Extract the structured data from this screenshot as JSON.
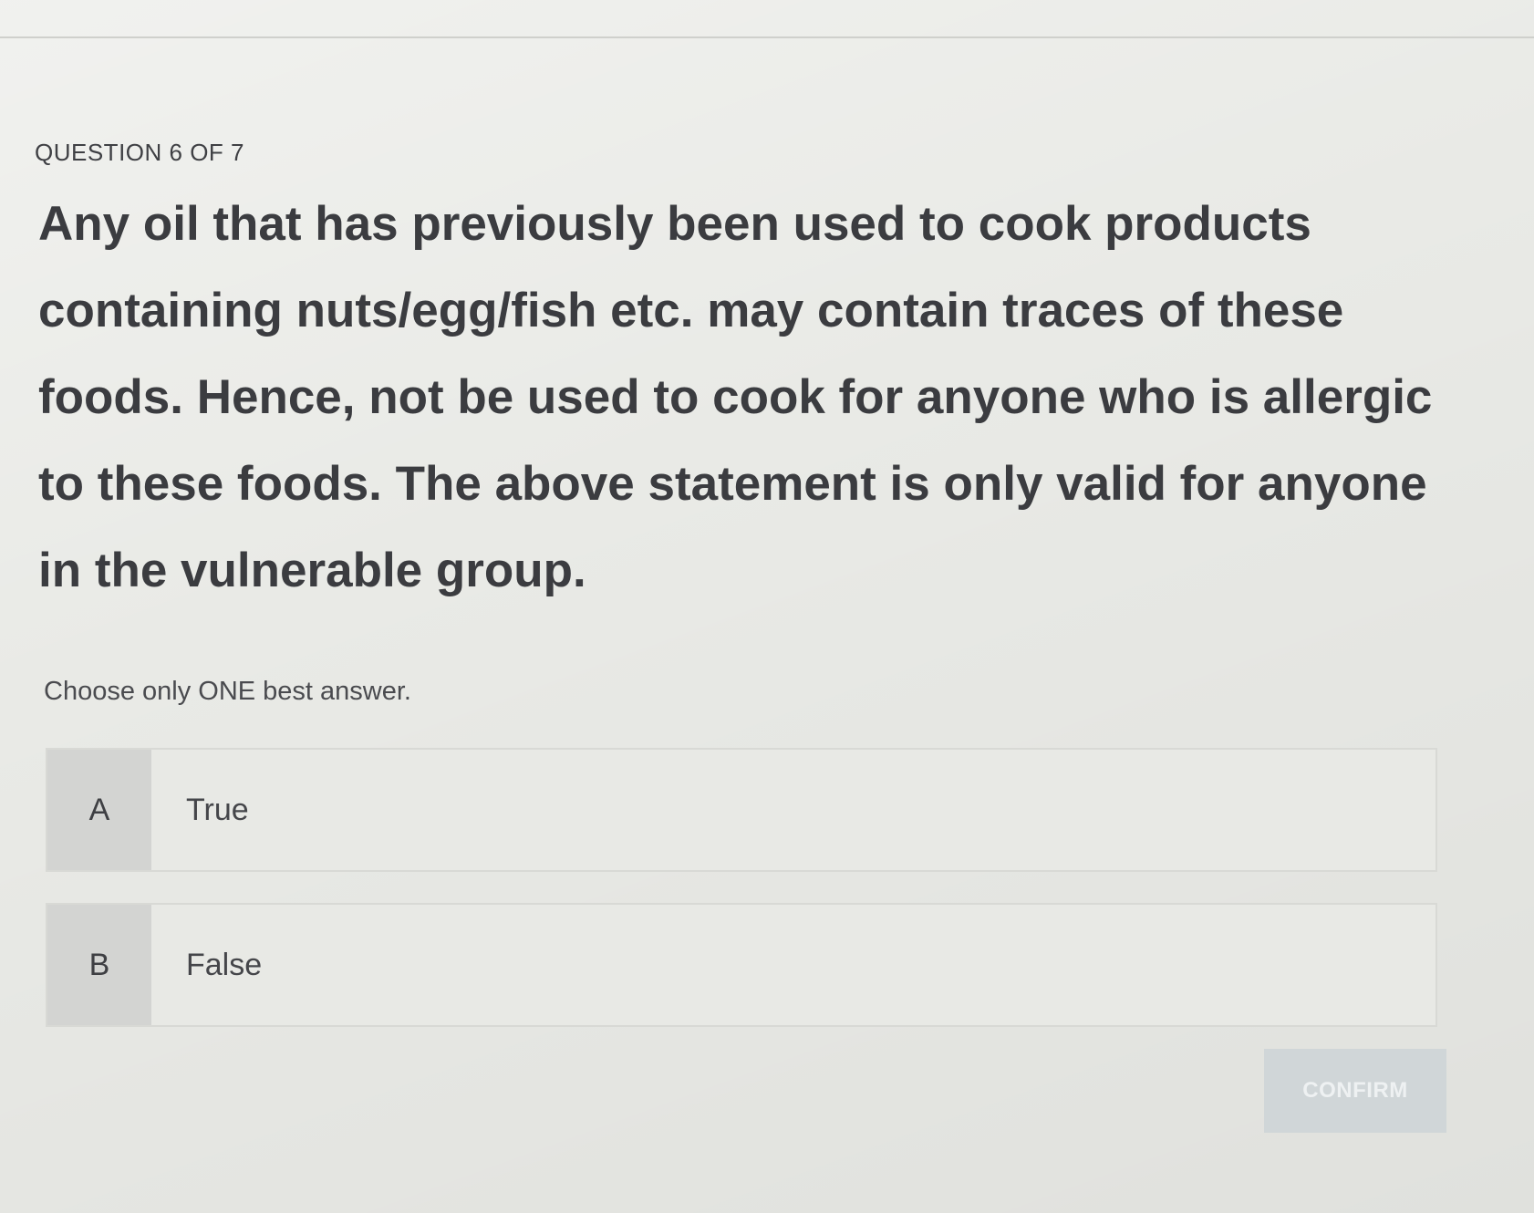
{
  "header": {
    "question_counter": "QUESTION 6 OF 7"
  },
  "question": {
    "text": "Any oil that has previously been used to cook products containing nuts/egg/fish etc. may contain traces of these foods. Hence, not be used to cook for anyone who is allergic to these foods. The above statement is only valid for anyone in the vulnerable group."
  },
  "instruction": "Choose only ONE best answer.",
  "options": [
    {
      "letter": "A",
      "label": "True"
    },
    {
      "letter": "B",
      "label": "False"
    }
  ],
  "actions": {
    "confirm_label": "CONFIRM",
    "confirm_enabled": false
  },
  "colors": {
    "background": "#e9eae6",
    "letter_box": "#d3d4d2",
    "confirm_disabled": "#d0d6d8"
  }
}
